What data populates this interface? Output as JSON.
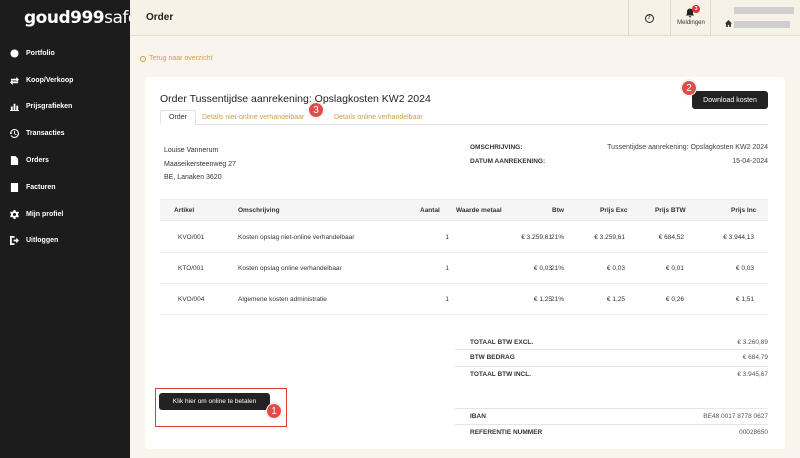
{
  "app": {
    "logo": {
      "bold": "goud999",
      "thin": "safe"
    },
    "page_title": "Order"
  },
  "sidebar": {
    "items": [
      {
        "label": "Portfolio",
        "icon": "circle-icon"
      },
      {
        "label": "Koop/Verkoop",
        "icon": "swap-icon"
      },
      {
        "label": "Prijsgrafieken",
        "icon": "chart-icon"
      },
      {
        "label": "Transacties",
        "icon": "history-icon"
      },
      {
        "label": "Orders",
        "icon": "file-icon"
      },
      {
        "label": "Facturen",
        "icon": "invoice-icon"
      },
      {
        "label": "Mijn profiel",
        "icon": "gear-icon"
      },
      {
        "label": "Uitloggen",
        "icon": "logout-icon"
      }
    ]
  },
  "topbar": {
    "help_glyph": "?",
    "notifications_label": "Meldingen",
    "notifications_count": "3"
  },
  "back_link": "Terug naar overzicht",
  "order": {
    "title": "Order Tussentijdse aanrekening: Opslagkosten KW2 2024",
    "download_label": "Download kosten",
    "tabs": [
      "Order",
      "Details niet-online verhandelbaar",
      "Details online verhandelbaar"
    ],
    "address": [
      "Louise Vannerum",
      "Maaseikersteenweg 27",
      "BE, Lanaken 3620"
    ],
    "omschrijving_label": "OMSCHRIJVING:",
    "omschrijving_value": "Tussentijdse aanrekening: Opslagkosten KW2 2024",
    "datum_label": "DATUM AANREKENING:",
    "datum_value": "15-04-2024"
  },
  "table": {
    "headers": [
      "Artikel",
      "Omschrijving",
      "Aantal",
      "Waarde metaal",
      "Btw",
      "Prijs Exc",
      "Prijs BTW",
      "Prijs Inc"
    ],
    "rows": [
      [
        "KVO/001",
        "Kosten opslag niet-online verhandelbaar",
        "1",
        "€ 3.259,61",
        "21%",
        "€ 3.259,61",
        "€ 684,52",
        "€ 3.944,13"
      ],
      [
        "KTO/001",
        "Kosten opslag online verhandelbaar",
        "1",
        "€ 0,03",
        "21%",
        "€ 0,03",
        "€ 0,01",
        "€ 0,03"
      ],
      [
        "KVO/004",
        "Algemene kosten administratie",
        "1",
        "€ 1,25",
        "21%",
        "€ 1,25",
        "€ 0,26",
        "€ 1,51"
      ]
    ]
  },
  "totals": [
    {
      "label": "TOTAAL BTW EXCL.",
      "value": "€ 3.260,89"
    },
    {
      "label": "BTW BEDRAG",
      "value": "€ 684,79"
    },
    {
      "label": "TOTAAL BTW INCL.",
      "value": "€ 3.945,67"
    }
  ],
  "bank": [
    {
      "label": "IBAN",
      "value": "BE48 0017 8778 0627"
    },
    {
      "label": "REFERENTIE NUMMER",
      "value": "00028650"
    }
  ],
  "pay_button": "Klik hier om online te betalen",
  "markers": [
    "1",
    "2",
    "3"
  ]
}
